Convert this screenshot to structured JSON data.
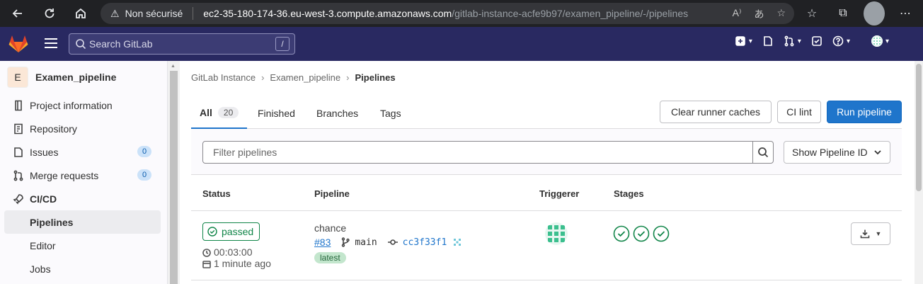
{
  "browser": {
    "security_label": "Non sécurisé",
    "url_host": "ec2-35-180-174-36.eu-west-3.compute.amazonaws.com",
    "url_path": "/gitlab-instance-acfe9b97/examen_pipeline/-/pipelines"
  },
  "header": {
    "search_placeholder": "Search GitLab",
    "search_shortcut": "/"
  },
  "sidebar": {
    "project_initial": "E",
    "project_name": "Examen_pipeline",
    "items": [
      {
        "label": "Project information"
      },
      {
        "label": "Repository"
      },
      {
        "label": "Issues",
        "count": "0"
      },
      {
        "label": "Merge requests",
        "count": "0"
      },
      {
        "label": "CI/CD"
      },
      {
        "label": "Pipelines"
      },
      {
        "label": "Editor"
      },
      {
        "label": "Jobs"
      }
    ]
  },
  "breadcrumb": [
    "GitLab Instance",
    "Examen_pipeline",
    "Pipelines"
  ],
  "tabs": [
    {
      "label": "All",
      "count": "20"
    },
    {
      "label": "Finished"
    },
    {
      "label": "Branches"
    },
    {
      "label": "Tags"
    }
  ],
  "actions": {
    "clear_caches": "Clear runner caches",
    "ci_lint": "CI lint",
    "run_pipeline": "Run pipeline"
  },
  "filter": {
    "placeholder": "Filter pipelines",
    "dropdown_label": "Show Pipeline ID"
  },
  "table": {
    "columns": [
      "Status",
      "Pipeline",
      "Triggerer",
      "Stages"
    ],
    "rows": [
      {
        "status": "passed",
        "duration": "00:03:00",
        "finished": "1 minute ago",
        "name": "chance",
        "id": "#83",
        "branch": "main",
        "commit": "cc3f33f1",
        "tag": "latest",
        "stages": [
          "passed",
          "passed",
          "passed"
        ]
      }
    ]
  },
  "colors": {
    "header_bg": "#292961",
    "primary": "#1f75cb",
    "success": "#108548"
  }
}
